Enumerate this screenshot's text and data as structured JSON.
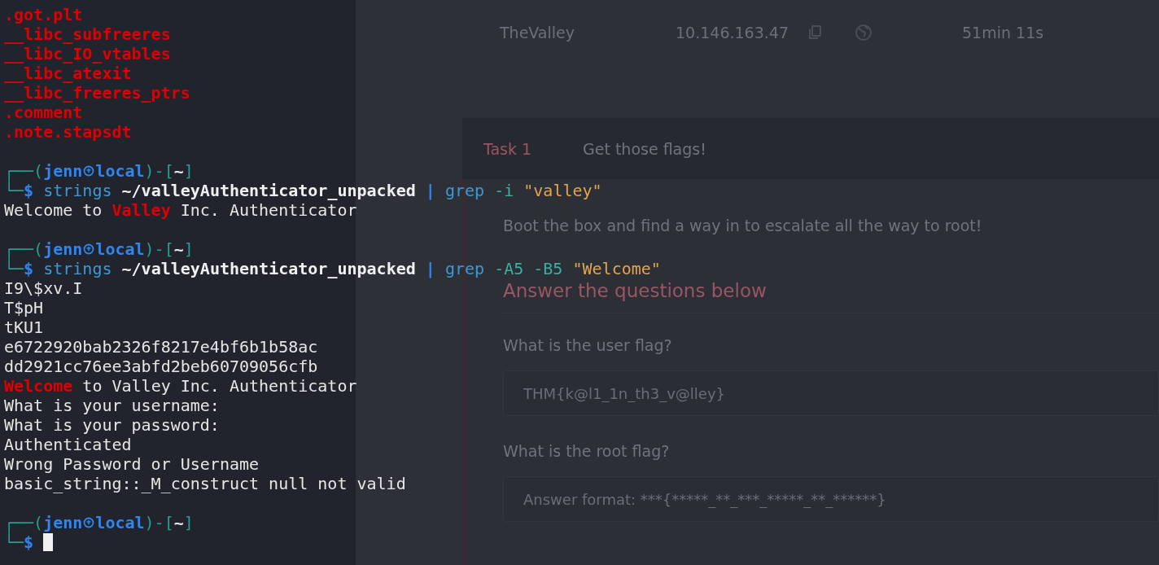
{
  "web_page": {
    "machine": {
      "name": "TheValley",
      "ip": "10.146.163.47",
      "time_left": "51min 11s"
    },
    "task": {
      "number": "Task 1",
      "title": "Get those flags!",
      "intro": "Boot the box and find a way in to escalate all the way to root!",
      "heading": "Answer the questions below",
      "questions": [
        {
          "question": "What is the user flag?",
          "value": "THM{k@l1_1n_th3_v@lley}"
        },
        {
          "question": "What is the root flag?",
          "placeholder": "Answer format: ***{*****_**_***_*****_**_******}"
        }
      ]
    }
  },
  "terminal": {
    "lines": [
      {
        "kind": "output",
        "segments": [
          {
            "text": ".got.plt",
            "match": true
          }
        ]
      },
      {
        "kind": "output",
        "segments": [
          {
            "text": "__libc_subfreeres",
            "match": true
          }
        ]
      },
      {
        "kind": "output",
        "segments": [
          {
            "text": "__libc_IO_vtables",
            "match": true
          }
        ]
      },
      {
        "kind": "output",
        "segments": [
          {
            "text": "__libc_atexit",
            "match": true
          }
        ]
      },
      {
        "kind": "output",
        "segments": [
          {
            "text": "__libc_freeres_ptrs",
            "match": true
          }
        ]
      },
      {
        "kind": "output",
        "segments": [
          {
            "text": ".comment",
            "match": true
          }
        ]
      },
      {
        "kind": "output",
        "segments": [
          {
            "text": ".note.stapsdt",
            "match": true
          }
        ]
      },
      {
        "kind": "blank"
      },
      {
        "kind": "prompt",
        "open": "┌──(",
        "user": "jenn",
        "host": "local",
        "sep": ")-[",
        "dir": "~",
        "close": "]"
      },
      {
        "kind": "command",
        "lead": "└─$",
        "program": "strings",
        "argument": "~/valleyAuthenticator_unpacked",
        "pipe": "|",
        "filter": "grep",
        "flags": "-i",
        "pattern": "\"valley\""
      },
      {
        "kind": "output",
        "segments": [
          {
            "text": "Welcome to ",
            "match": false
          },
          {
            "text": "Valley",
            "match": true
          },
          {
            "text": " Inc. Authenticator",
            "match": false
          }
        ]
      },
      {
        "kind": "blank"
      },
      {
        "kind": "prompt",
        "open": "┌──(",
        "user": "jenn",
        "host": "local",
        "sep": ")-[",
        "dir": "~",
        "close": "]"
      },
      {
        "kind": "command",
        "lead": "└─$",
        "program": "strings",
        "argument": "~/valleyAuthenticator_unpacked",
        "pipe": "|",
        "filter": "grep",
        "flags": "-A5 -B5",
        "pattern": "\"Welcome\""
      },
      {
        "kind": "output",
        "segments": [
          {
            "text": "I9\\$xv.I",
            "match": false
          }
        ]
      },
      {
        "kind": "output",
        "segments": [
          {
            "text": "T$pH",
            "match": false
          }
        ]
      },
      {
        "kind": "output",
        "segments": [
          {
            "text": "tKU1",
            "match": false
          }
        ]
      },
      {
        "kind": "output",
        "segments": [
          {
            "text": "e6722920bab2326f8217e4bf6b1b58ac",
            "match": false
          }
        ]
      },
      {
        "kind": "output",
        "segments": [
          {
            "text": "dd2921cc76ee3abfd2beb60709056cfb",
            "match": false
          }
        ]
      },
      {
        "kind": "output",
        "segments": [
          {
            "text": "Welcome",
            "match": true
          },
          {
            "text": " to Valley Inc. Authenticator",
            "match": false
          }
        ]
      },
      {
        "kind": "output",
        "segments": [
          {
            "text": "What is your username:",
            "match": false
          }
        ]
      },
      {
        "kind": "output",
        "segments": [
          {
            "text": "What is your password:",
            "match": false
          }
        ]
      },
      {
        "kind": "output",
        "segments": [
          {
            "text": "Authenticated",
            "match": false
          }
        ]
      },
      {
        "kind": "output",
        "segments": [
          {
            "text": "Wrong Password or Username",
            "match": false
          }
        ]
      },
      {
        "kind": "output",
        "segments": [
          {
            "text": "basic_string::_M_construct null not valid",
            "match": false
          }
        ]
      },
      {
        "kind": "blank"
      },
      {
        "kind": "prompt",
        "open": "┌──(",
        "user": "jenn",
        "host": "local",
        "sep": ")-[",
        "dir": "~",
        "close": "]"
      },
      {
        "kind": "input",
        "lead": "└─$"
      }
    ]
  }
}
